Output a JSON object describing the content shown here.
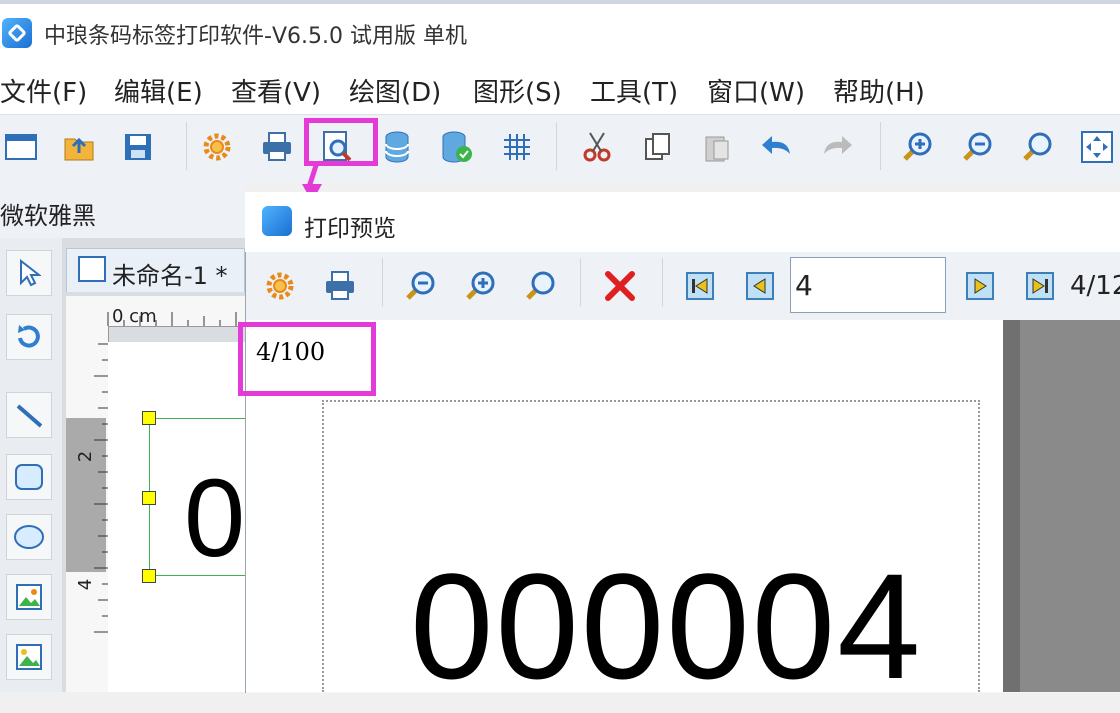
{
  "window": {
    "title": "中琅条码标签打印软件-V6.5.0 试用版 单机"
  },
  "menu": [
    "文件(F)",
    "编辑(E)",
    "查看(V)",
    "绘图(D)",
    "图形(S)",
    "工具(T)",
    "窗口(W)",
    "帮助(H)"
  ],
  "toolbar": {
    "icons": [
      "new-icon",
      "open-icon",
      "save-icon",
      "settings-gear-icon",
      "print-icon",
      "print-preview-icon",
      "database-icon",
      "database-connect-icon",
      "grid-icon",
      "cut-icon",
      "copy-icon",
      "paste-icon",
      "undo-icon",
      "redo-icon",
      "zoom-in-icon",
      "zoom-out-icon",
      "zoom-fit-icon",
      "fit-page-icon"
    ]
  },
  "font_bar": {
    "font_name": "微软雅黑"
  },
  "document": {
    "tab_title": "未命名-1 *",
    "ruler_origin": "0 cm",
    "ruler_marks": [
      "2",
      "4"
    ],
    "label_text_fragment": "0"
  },
  "preview_dialog": {
    "title": "打印预览",
    "page_input_value": "4",
    "page_total": "4/12",
    "counter": "4/100",
    "serial": "000004"
  },
  "colors": {
    "highlight": "#e43ad8",
    "accent": "#1b6fd1"
  }
}
